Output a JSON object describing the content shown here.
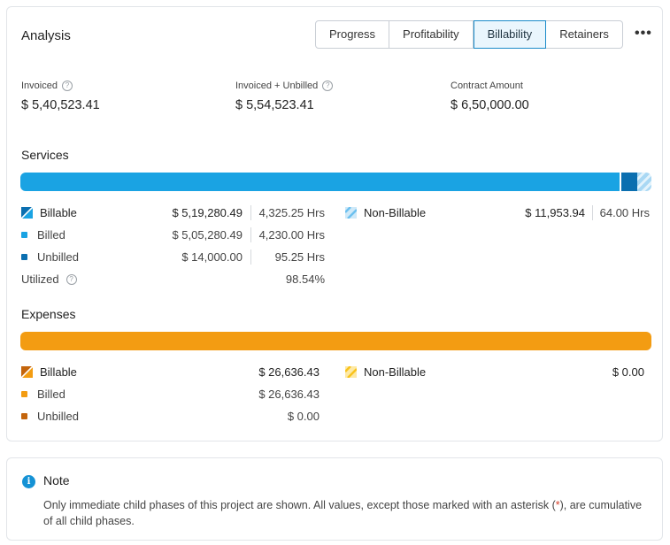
{
  "analysis": {
    "title": "Analysis",
    "tabs": [
      "Progress",
      "Profitability",
      "Billability",
      "Retainers"
    ],
    "active_tab": "Billability",
    "more_label": "•••"
  },
  "summary": {
    "invoiced_label": "Invoiced",
    "invoiced_value": "$ 5,40,523.41",
    "invoiced_unbilled_label": "Invoiced + Unbilled",
    "invoiced_unbilled_value": "$ 5,54,523.41",
    "contract_label": "Contract Amount",
    "contract_value": "$ 6,50,000.00"
  },
  "services": {
    "title": "Services",
    "bar": {
      "billed_fraction": 0.9732,
      "unbilled_fraction": 0.027,
      "nonbillable_fraction": 0.0225
    },
    "billable_label": "Billable",
    "billable_amount": "$ 5,19,280.49",
    "billable_hours": "4,325.25 Hrs",
    "billed_label": "Billed",
    "billed_amount": "$ 5,05,280.49",
    "billed_hours": "4,230.00 Hrs",
    "unbilled_label": "Unbilled",
    "unbilled_amount": "$ 14,000.00",
    "unbilled_hours": "95.25 Hrs",
    "utilized_label": "Utilized",
    "utilized_value": "98.54%",
    "nonbillable_label": "Non-Billable",
    "nonbillable_amount": "$ 11,953.94",
    "nonbillable_hours": "64.00 Hrs"
  },
  "expenses": {
    "title": "Expenses",
    "bar": {
      "billed_fraction": 1.0
    },
    "billable_label": "Billable",
    "billable_amount": "$ 26,636.43",
    "billed_label": "Billed",
    "billed_amount": "$ 26,636.43",
    "unbilled_label": "Unbilled",
    "unbilled_amount": "$ 0.00",
    "nonbillable_label": "Non-Billable",
    "nonbillable_amount": "$ 0.00"
  },
  "note": {
    "icon": "info-icon",
    "title": "Note",
    "text_before": "Only immediate child phases of this project are shown. All values, except those marked with an asterisk (",
    "asterisk": "*",
    "text_after": "), are cumulative of all child phases."
  },
  "colors": {
    "services_billed": "#1aa3e3",
    "services_unbilled": "#0b6fb0",
    "services_nonbillable": "#a9d8f4",
    "expenses_billed": "#f39c12",
    "expenses_unbilled": "#c4650c",
    "expenses_nonbillable": "#f9cf3b",
    "accent": "#1b8bc9"
  }
}
